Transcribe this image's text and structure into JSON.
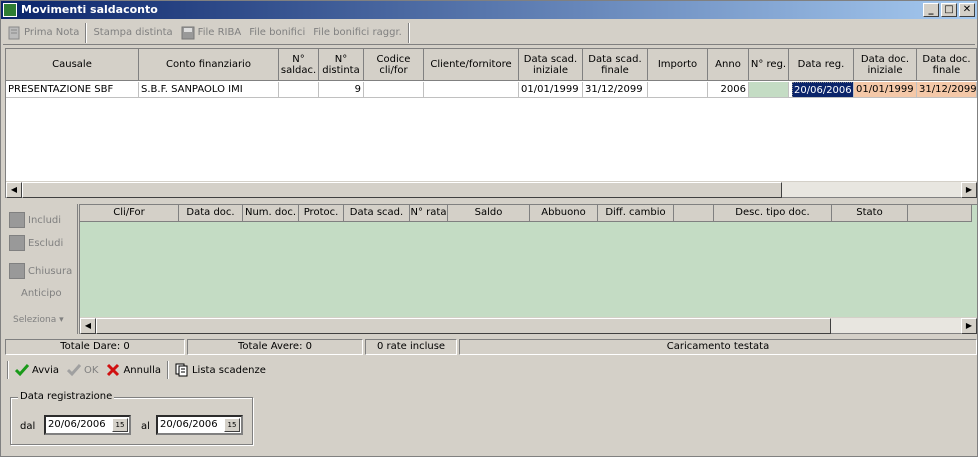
{
  "window": {
    "title": "Movimenti saldaconto",
    "buttons": [
      "_",
      "□",
      "✕"
    ]
  },
  "toolbar": [
    {
      "label": "Prima Nota",
      "enabled": false,
      "icon": "note-icon"
    },
    {
      "label": "Stampa distinta",
      "enabled": false
    },
    {
      "label": "File RIBA",
      "enabled": false,
      "icon": "floppy-icon"
    },
    {
      "label": "File bonifici",
      "enabled": false
    },
    {
      "label": "File bonifici raggr.",
      "enabled": false
    }
  ],
  "grid1": {
    "headers": [
      "Causale",
      "Conto finanziario",
      "N°\nsaldac.",
      "N°\ndistinta",
      "Codice\ncli/for",
      "Cliente/fornitore",
      "Data scad.\niniziale",
      "Data scad.\nfinale",
      "Importo",
      "Anno",
      "N° reg.",
      "Data reg.",
      "Data doc.\niniziale",
      "Data doc.\nfinale"
    ],
    "row": [
      "PRESENTAZIONE SBF",
      "S.B.F. SANPAOLO IMI",
      "",
      "9",
      "",
      "",
      "01/01/1999",
      "31/12/2099",
      "",
      "2006",
      "",
      "20/06/2006",
      "01/01/1999",
      "31/12/2099"
    ]
  },
  "leftpanel": {
    "includi": "Includi",
    "escludi": "Escludi",
    "chiusura": "Chiusura",
    "anticipo": "Anticipo",
    "seleziona": "Seleziona ▾"
  },
  "grid2": {
    "headers": [
      "Cli/For",
      "Data doc.",
      "Num. doc.",
      "Protoc.",
      "Data scad.",
      "N° rata",
      "Saldo",
      "Abbuono",
      "Diff. cambio",
      "",
      "Desc. tipo doc.",
      "Stato",
      ""
    ]
  },
  "status": {
    "dare": "Totale Dare: 0",
    "avere": "Totale Avere: 0",
    "rate": "0 rate incluse",
    "caricamento": "Caricamento testata"
  },
  "actions": {
    "avvia": "Avvia",
    "ok": "OK",
    "annulla": "Annulla",
    "lista": "Lista scadenze"
  },
  "filter": {
    "legend": "Data registrazione",
    "dal_label": "dal",
    "dal": "20/06/2006",
    "al_label": "al",
    "al": "20/06/2006",
    "cal": "15"
  },
  "colors": {
    "row_green": "#c4dcc4",
    "selected": "#0a246a",
    "orange": "#f4c8a8",
    "title_start": "#0a246a"
  }
}
